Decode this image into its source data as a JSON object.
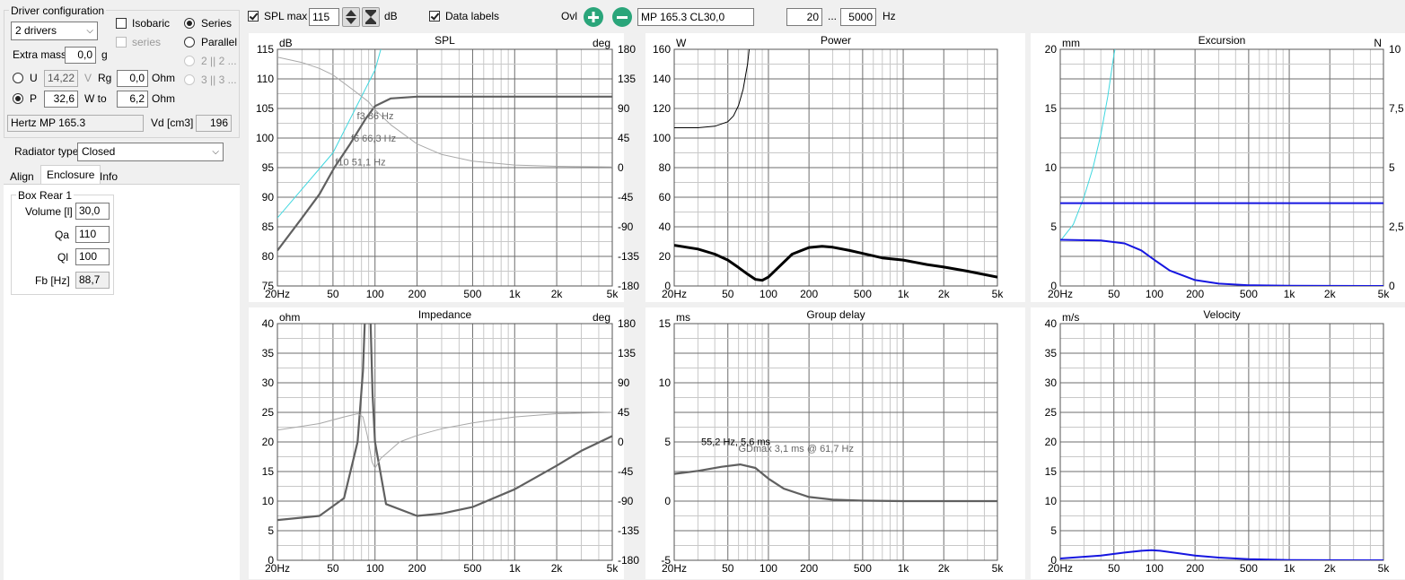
{
  "driver_config": {
    "title": "Driver configuration",
    "drivers_select": "2 drivers",
    "isobaric_label": "Isobaric",
    "series_sub_label": "series",
    "series_label": "Series",
    "parallel_label": "Parallel",
    "p22_label": "2 || 2 ...",
    "p33_label": "3 || 3 ...",
    "extra_mass_label": "Extra mass",
    "extra_mass_value": "0,0",
    "extra_mass_unit": "g",
    "u_label": "U",
    "u_value": "14,22",
    "u_unit": "V",
    "rg_label": "Rg",
    "rg_value": "0,0",
    "rg_unit": "Ohm",
    "p_label": "P",
    "p_value": "32,6",
    "wto_label": "W to",
    "wto_value": "6,2",
    "wto_unit": "Ohm",
    "driver_name": "Hertz MP 165.3",
    "vd_label": "Vd [cm3]",
    "vd_value": "196"
  },
  "radiator": {
    "label": "Radiator type",
    "value": "Closed"
  },
  "tabs": [
    "Align",
    "Enclosure",
    "Info"
  ],
  "enclosure": {
    "group_title": "Box Rear 1",
    "volume_label": "Volume [l]",
    "volume_value": "30,0",
    "qa_label": "Qa",
    "qa_value": "110",
    "ql_label": "Ql",
    "ql_value": "100",
    "fb_label": "Fb [Hz]",
    "fb_value": "88,7"
  },
  "toolbar": {
    "spl_max_label": "SPL max",
    "spl_max_value": "115",
    "spl_unit": "dB",
    "data_labels_label": "Data labels",
    "ovl_label": "Ovl",
    "overlay_name": "MP 165.3 CL30,0",
    "freq_from": "20",
    "freq_sep": "...",
    "freq_to": "5000",
    "freq_unit": "Hz"
  },
  "x_ticks": [
    "20Hz",
    "50",
    "100",
    "200",
    "500",
    "1k",
    "2k",
    "5k"
  ],
  "charts": {
    "spl": {
      "title": "SPL",
      "left_unit": "dB",
      "right_unit": "deg",
      "left_ticks": [
        "115",
        "110",
        "105",
        "100",
        "95",
        "90",
        "85",
        "80",
        "75"
      ],
      "right_ticks": [
        "180",
        "135",
        "90",
        "45",
        "0",
        "-45",
        "-90",
        "-135",
        "-180"
      ],
      "annotations": [
        "f3 86 Hz",
        "f6 66,3 Hz",
        "f10 51,1 Hz"
      ]
    },
    "power": {
      "title": "Power",
      "left_unit": "W",
      "left_ticks": [
        "160",
        "140",
        "120",
        "100",
        "80",
        "60",
        "40",
        "20",
        "0"
      ]
    },
    "excursion": {
      "title": "Excursion",
      "left_unit": "mm",
      "right_unit": "N",
      "left_ticks": [
        "20",
        "15",
        "10",
        "5",
        "0"
      ],
      "right_ticks": [
        "10",
        "7,5",
        "5",
        "2,5",
        "0"
      ]
    },
    "impedance": {
      "title": "Impedance",
      "left_unit": "ohm",
      "right_unit": "deg",
      "left_ticks": [
        "40",
        "35",
        "30",
        "25",
        "20",
        "15",
        "10",
        "5",
        "0"
      ],
      "right_ticks": [
        "180",
        "135",
        "90",
        "45",
        "0",
        "-45",
        "-90",
        "-135",
        "-180"
      ]
    },
    "group_delay": {
      "title": "Group delay",
      "left_unit": "ms",
      "left_ticks": [
        "15",
        "10",
        "5",
        "0",
        "-5"
      ],
      "annotations": [
        "55,2 Hz, 5,6 ms",
        "GDmax 3,1 ms  @ 61,7 Hz"
      ]
    },
    "velocity": {
      "title": "Velocity",
      "left_unit": "m/s",
      "left_ticks": [
        "40",
        "35",
        "30",
        "25",
        "20",
        "15",
        "10",
        "5",
        "0"
      ]
    }
  },
  "chart_data": [
    {
      "type": "line",
      "title": "SPL",
      "ylabel": "dB",
      "y2label": "deg",
      "ylim": [
        75,
        115
      ],
      "y2lim": [
        -180,
        180
      ],
      "xlim": [
        20,
        5000
      ],
      "xscale": "log",
      "series": [
        {
          "axis": "left",
          "color": "#606060",
          "x": [
            20,
            30,
            40,
            51.1,
            66.3,
            86,
            100,
            130,
            200,
            500,
            1000,
            5000
          ],
          "y": [
            81,
            86.5,
            90.5,
            95,
            99,
            103.3,
            105.4,
            106.7,
            107,
            107,
            107,
            107
          ]
        },
        {
          "axis": "left",
          "color": "#3fd7df",
          "x": [
            20,
            50,
            100,
            110
          ],
          "y": [
            86.5,
            97.5,
            111.5,
            115
          ]
        },
        {
          "axis": "right",
          "color": "#a8a8a8",
          "x": [
            20,
            30,
            40,
            50,
            70,
            90,
            100,
            130,
            200,
            300,
            500,
            1000,
            2000,
            5000
          ],
          "y": [
            168,
            160,
            151,
            141,
            118,
            100,
            88,
            65,
            36,
            20,
            10,
            4,
            2,
            1
          ]
        }
      ]
    },
    {
      "type": "line",
      "title": "Power",
      "ylabel": "W",
      "ylim": [
        0,
        160
      ],
      "xlim": [
        20,
        5000
      ],
      "xscale": "log",
      "series": [
        {
          "color": "#000000",
          "width": 1,
          "x": [
            20,
            30,
            40,
            50,
            55,
            60,
            65,
            70,
            72,
            74
          ],
          "y": [
            107,
            107,
            108,
            111,
            115,
            122,
            133,
            150,
            160,
            175
          ]
        },
        {
          "color": "#000000",
          "width": 3,
          "x": [
            20,
            30,
            40,
            50,
            60,
            70,
            80,
            90,
            100,
            120,
            150,
            200,
            250,
            300,
            400,
            500,
            700,
            1000,
            1500,
            2000,
            3000,
            5000
          ],
          "y": [
            27.5,
            25,
            21.5,
            17.5,
            12.5,
            8,
            4.5,
            3.8,
            6,
            13,
            21.5,
            26,
            26.8,
            26.2,
            24,
            22,
            19,
            17.5,
            14.5,
            12.8,
            10,
            6
          ]
        }
      ]
    },
    {
      "type": "line",
      "title": "Excursion",
      "ylabel": "mm",
      "y2label": "N",
      "ylim": [
        0,
        20
      ],
      "y2lim": [
        0,
        10
      ],
      "xlim": [
        20,
        5000
      ],
      "xscale": "log",
      "series": [
        {
          "axis": "left",
          "color": "#3fd7df",
          "x": [
            20,
            25,
            30,
            35,
            40,
            45,
            50,
            53
          ],
          "y": [
            3.8,
            5.2,
            7.5,
            10,
            12.8,
            16,
            19.5,
            21
          ]
        },
        {
          "axis": "right",
          "color": "#1616e0",
          "x": [
            20,
            5000
          ],
          "y": [
            3.5,
            3.5
          ]
        },
        {
          "axis": "left",
          "color": "#1616e0",
          "x": [
            20,
            40,
            60,
            80,
            100,
            130,
            200,
            300,
            500,
            1000,
            5000
          ],
          "y": [
            3.9,
            3.85,
            3.6,
            3,
            2.2,
            1.3,
            0.5,
            0.2,
            0.06,
            0.02,
            0
          ]
        }
      ]
    },
    {
      "type": "line",
      "title": "Impedance",
      "ylabel": "ohm",
      "y2label": "deg",
      "ylim": [
        0,
        40
      ],
      "y2lim": [
        -180,
        180
      ],
      "xlim": [
        20,
        5000
      ],
      "xscale": "log",
      "series": [
        {
          "axis": "left",
          "color": "#606060",
          "x": [
            20,
            40,
            60,
            75,
            82,
            86,
            88.7,
            92,
            96,
            100,
            120,
            200,
            300,
            500,
            1000,
            2000,
            3000,
            5000
          ],
          "y": [
            6.8,
            7.5,
            10.5,
            20,
            32,
            45,
            50,
            44,
            28,
            20,
            9.5,
            7.5,
            7.9,
            9,
            12,
            16,
            18.5,
            21
          ]
        },
        {
          "axis": "right",
          "color": "#a8a8a8",
          "x": [
            20,
            40,
            60,
            75,
            82,
            88,
            95,
            100,
            110,
            150,
            200,
            300,
            500,
            1000,
            2000,
            5000
          ],
          "y": [
            18,
            28,
            38,
            43,
            38,
            10,
            -30,
            -40,
            -25,
            0,
            10,
            20,
            29,
            38,
            43,
            45
          ]
        }
      ]
    },
    {
      "type": "line",
      "title": "Group delay",
      "ylabel": "ms",
      "ylim": [
        -5,
        15
      ],
      "xlim": [
        20,
        5000
      ],
      "xscale": "log",
      "series": [
        {
          "color": "#606060",
          "x": [
            20,
            30,
            45,
            61.7,
            80,
            100,
            130,
            200,
            300,
            500,
            1000,
            5000
          ],
          "y": [
            2.3,
            2.55,
            2.9,
            3.1,
            2.8,
            1.9,
            1.05,
            0.35,
            0.12,
            0.04,
            0,
            0
          ]
        }
      ]
    },
    {
      "type": "line",
      "title": "Velocity",
      "ylabel": "m/s",
      "ylim": [
        0,
        40
      ],
      "xlim": [
        20,
        5000
      ],
      "xscale": "log",
      "series": [
        {
          "color": "#1616e0",
          "x": [
            20,
            40,
            60,
            80,
            95,
            110,
            150,
            200,
            300,
            500,
            1000,
            5000
          ],
          "y": [
            0.3,
            0.8,
            1.3,
            1.6,
            1.7,
            1.6,
            1.2,
            0.8,
            0.45,
            0.2,
            0.05,
            0
          ]
        }
      ]
    }
  ]
}
